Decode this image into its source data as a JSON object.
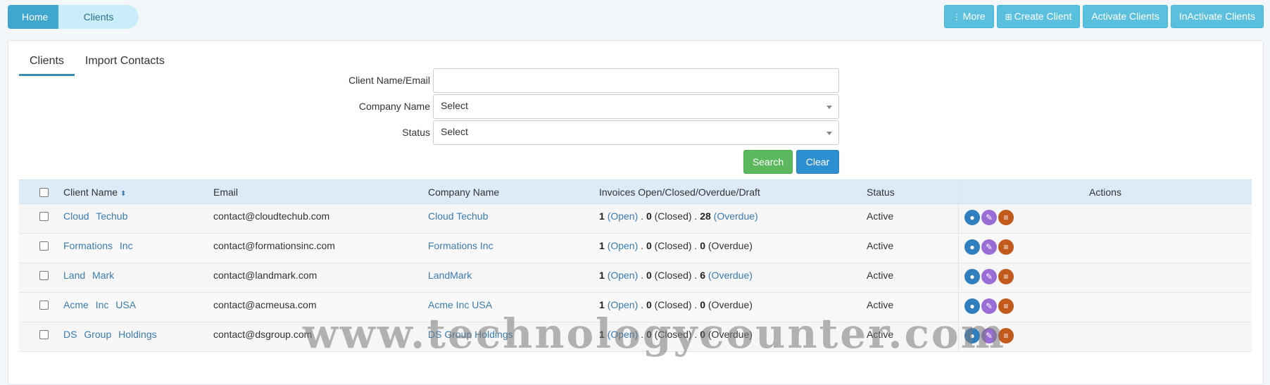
{
  "breadcrumb": {
    "home": "Home",
    "current": "Clients"
  },
  "toolbar": {
    "more": "More",
    "create_client": "Create Client",
    "activate_clients": "Activate Clients",
    "inactivate_clients": "InActivate Clients"
  },
  "tabs": [
    {
      "label": "Clients"
    },
    {
      "label": "Import Contacts"
    }
  ],
  "filters": {
    "name_label": "Client Name/Email",
    "name_value": "",
    "company_label": "Company Name",
    "company_value": "Select",
    "status_label": "Status",
    "status_value": "Select",
    "search_button": "Search",
    "clear_button": "Clear"
  },
  "table": {
    "headers": {
      "client_name": "Client Name",
      "email": "Email",
      "company": "Company Name",
      "invoices": "Invoices Open/Closed/Overdue/Draft",
      "status": "Status",
      "actions": "Actions"
    },
    "rows": [
      {
        "name": "Cloud Techub",
        "email": "contact@cloudtechub.com",
        "company": "Cloud Techub",
        "open": "1",
        "closed": "0",
        "overdue": "28",
        "status": "Active"
      },
      {
        "name": "Formations Inc",
        "email": "contact@formationsinc.com",
        "company": "Formations Inc",
        "open": "1",
        "closed": "0",
        "overdue": "0",
        "status": "Active"
      },
      {
        "name": "Land Mark",
        "email": "contact@landmark.com",
        "company": "LandMark",
        "open": "1",
        "closed": "0",
        "overdue": "6",
        "status": "Active"
      },
      {
        "name": "Acme Inc USA",
        "email": "contact@acmeusa.com",
        "company": "Acme Inc USA",
        "open": "1",
        "closed": "0",
        "overdue": "0",
        "status": "Active"
      },
      {
        "name": "DS Group Holdings",
        "email": "contact@dsgroup.com",
        "company": "DS Group Holdings",
        "open": "1",
        "closed": "0",
        "overdue": "0",
        "status": "Active"
      }
    ],
    "invoice_labels": {
      "open": "(Open)",
      "closed": "(Closed)",
      "overdue": "(Overdue)"
    }
  },
  "watermark": "www.technologycounter.com",
  "colors": {
    "accent": "#3ea6cf",
    "button_info": "#5bc0de",
    "search": "#5cb85c",
    "clear": "#2e8fd0"
  },
  "icons": [
    "more-icon",
    "plus-square-icon",
    "sort-icon",
    "eye-icon",
    "edit-icon",
    "notes-icon"
  ]
}
